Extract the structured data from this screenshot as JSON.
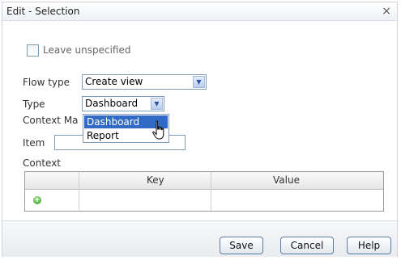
{
  "dialog": {
    "title": "Edit - Selection",
    "close_glyph": "×"
  },
  "form": {
    "leave_unspecified_label": "Leave unspecified",
    "leave_unspecified_checked": false,
    "flow_type_label": "Flow type",
    "flow_type_value": "Create view",
    "type_label": "Type",
    "type_value": "Dashboard",
    "context_mapping_label_visible": "Context Ma",
    "item_label": "Item",
    "item_value": "",
    "context_label": "Context"
  },
  "type_dropdown": {
    "options": [
      "Dashboard",
      "Report"
    ],
    "highlighted": "Dashboard"
  },
  "context_table": {
    "columns": [
      "",
      "Key",
      "Value"
    ],
    "rows": []
  },
  "buttons": {
    "save": "Save",
    "cancel": "Cancel",
    "help": "Help"
  },
  "colors": {
    "selection_highlight": "#316ac5",
    "add_icon": "#2f9a21",
    "button_border": "#5a7ca8"
  },
  "icons": {
    "add_row": "green-plus-circle",
    "dropdown_arrow": "chevron-down",
    "cursor": "hand-pointer"
  }
}
